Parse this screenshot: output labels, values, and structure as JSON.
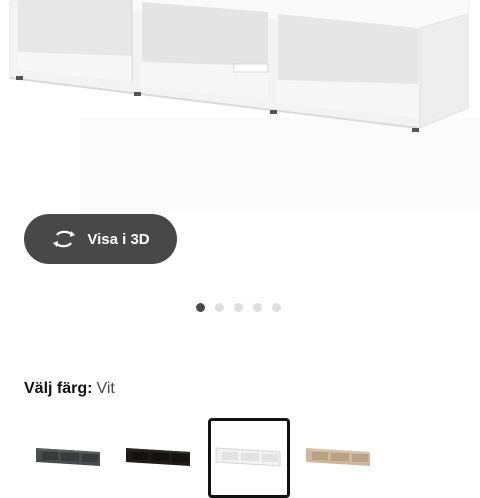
{
  "view3d": {
    "label": "Visa i 3D",
    "icon": "rotate-3d-icon"
  },
  "carousel": {
    "total": 5,
    "active": 0
  },
  "color": {
    "label": "Välj färg:",
    "selected": "Vit",
    "options": [
      {
        "name": "dark-grey",
        "selected": false
      },
      {
        "name": "black-brown",
        "selected": false
      },
      {
        "name": "white",
        "selected": true
      },
      {
        "name": "oak-effect",
        "selected": false
      }
    ]
  },
  "colors": {
    "button_bg": "#484848",
    "dot_active": "#484848",
    "dot_inactive": "#dfdfdf",
    "selected_border": "#111111"
  }
}
